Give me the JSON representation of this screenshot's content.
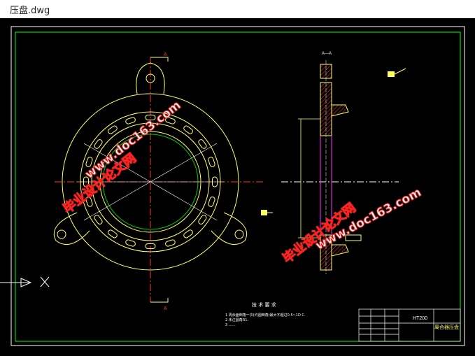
{
  "window": {
    "title": "压盘.dwg"
  },
  "drawing": {
    "section_label": "A—A",
    "cut_marker_top": "A",
    "cut_marker_bottom": "A",
    "tech_req": {
      "heading": "技 术 要 求",
      "lines": [
        "1  周余面倒角一次(约圆倒角)最大不超过0.5~1D C.",
        "2  未注圆角R1.",
        "3  ……"
      ]
    },
    "title_block": {
      "material": "HT200",
      "part_name": "离合器压盘"
    }
  },
  "watermarks": {
    "site": "www.doc163.com",
    "brand": "毕业设计论文网"
  },
  "colors": {
    "background": "#000000",
    "frame": "#00ff00",
    "geometry": "#ffff66",
    "centerline": "#ff3333",
    "green_circle": "#00cc00",
    "magenta": "#ff33ff",
    "hatch": "#ff3333",
    "watermark": "#ff2020"
  }
}
